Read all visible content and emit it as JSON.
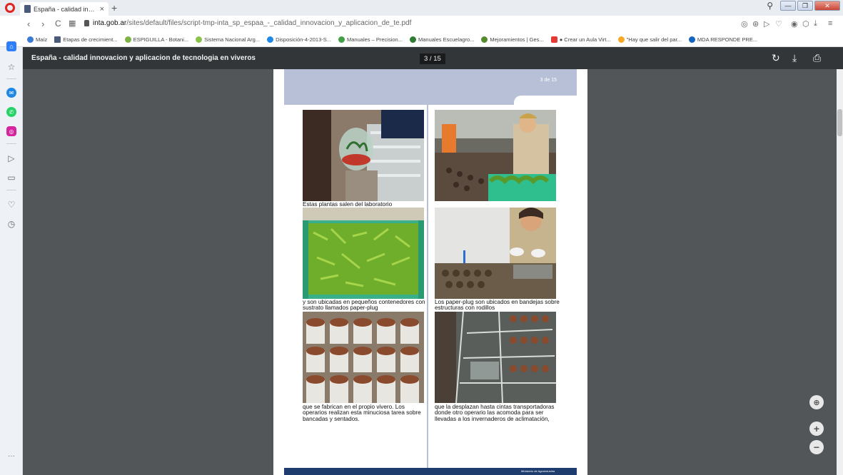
{
  "browser": {
    "tab_title": "España - calidad innovacion y",
    "tab_close": "×",
    "new_tab": "+",
    "url_host": "inta.gob.ar",
    "url_path": "/sites/default/files/script-tmp-inta_sp_espaa_-_calidad_innovacion_y_aplicacion_de_te.pdf",
    "win_min": "—",
    "win_max": "❐",
    "win_close": "✕"
  },
  "bookmarks": [
    {
      "label": "Maíz",
      "color": "#3a7bd5"
    },
    {
      "label": "Etapas de crecimient...",
      "color": "#4a5a7a"
    },
    {
      "label": "ESPIGUILLA - Botani...",
      "color": "#7cb342"
    },
    {
      "label": "Sistema Nacional Arg...",
      "color": "#8bc34a"
    },
    {
      "label": "Disposición-4-2013-S...",
      "color": "#1e88e5"
    },
    {
      "label": "Manuales – Precision...",
      "color": "#43a047"
    },
    {
      "label": "Manuales Escuelagro...",
      "color": "#2e7d32"
    },
    {
      "label": "Mejoramientos | Ges...",
      "color": "#558b2f"
    },
    {
      "label": "● Crear un Aula Virt...",
      "color": "#e53935"
    },
    {
      "label": "\"Hay que salir del par...",
      "color": "#f9a825"
    },
    {
      "label": "MDA RESPONDE PRE...",
      "color": "#1565c0"
    }
  ],
  "pdf": {
    "title": "España - calidad innovacion y aplicacion de tecnologia en viveros",
    "page_indicator": "3 / 15",
    "page_label": "3 de 15",
    "footer_text": "Ministerio de Agroindustria"
  },
  "captions": {
    "c1": "Estas plantas salen del laboratorio",
    "c2": "y son ubicadas en pequeños contenedores con sustrato llamados paper-plug",
    "c3": "Los paper-plug son ubicados en bandejas sobre estructuras con rodillos",
    "c4": "que se fabrican en el propio vivero. Los operarios realizan esta minuciosa tarea sobre bancadas y sentados.",
    "c5": "que la desplazan hasta cintas transportadoras donde otro operario las acomoda para ser llevadas a los invernaderos de aclimatación,"
  },
  "zoom": {
    "fit": "⊕",
    "plus": "+",
    "minus": "−"
  },
  "icons": {
    "back": "‹",
    "forward": "›",
    "reload": "C",
    "grid": "▦",
    "rotate": "↻",
    "download": "⤓",
    "print": "⎙"
  }
}
